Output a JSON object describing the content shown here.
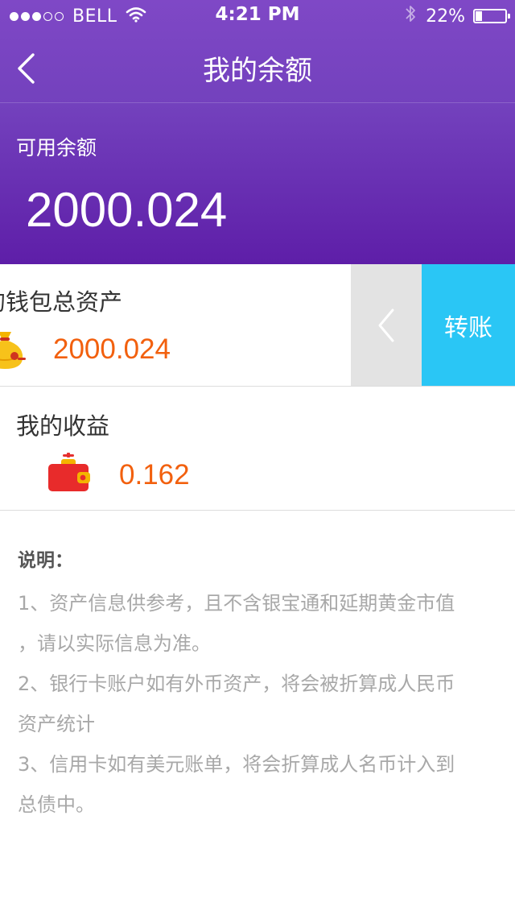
{
  "status_bar": {
    "carrier": "BELL",
    "time": "4:21 PM",
    "battery_percent_text": "22%",
    "battery_level": 0.22,
    "signal_filled": 3,
    "signal_total": 5
  },
  "nav": {
    "title": "我的余额"
  },
  "balance": {
    "label": "可用余额",
    "value": "2000.024"
  },
  "wallet": {
    "title": "的钱包总资产",
    "value": "2000.024",
    "action_label": "转账"
  },
  "earnings": {
    "title": "我的收益",
    "value": "0.162"
  },
  "notes": {
    "title": "说明：",
    "lines": [
      "1、资产信息供参考，且不含银宝通和延期黄金市值",
      "，请以实际信息为准。",
      "2、银行卡账户如有外币资产，将会被折算成人民币",
      "资产统计",
      "3、信用卡如有美元账单，将会折算成人名币计入到",
      "总债中。"
    ]
  },
  "colors": {
    "header_top": "#7f48c6",
    "header_bottom": "#5e1ea8",
    "amount_orange": "#f2600e",
    "transfer_blue": "#2ac6f5",
    "note_gray": "#a8a8a8"
  },
  "icons": {
    "back": "chevron-left-icon",
    "wallet": "money-bag-icon",
    "earnings": "red-purse-icon",
    "reveal": "chevron-left-icon"
  }
}
